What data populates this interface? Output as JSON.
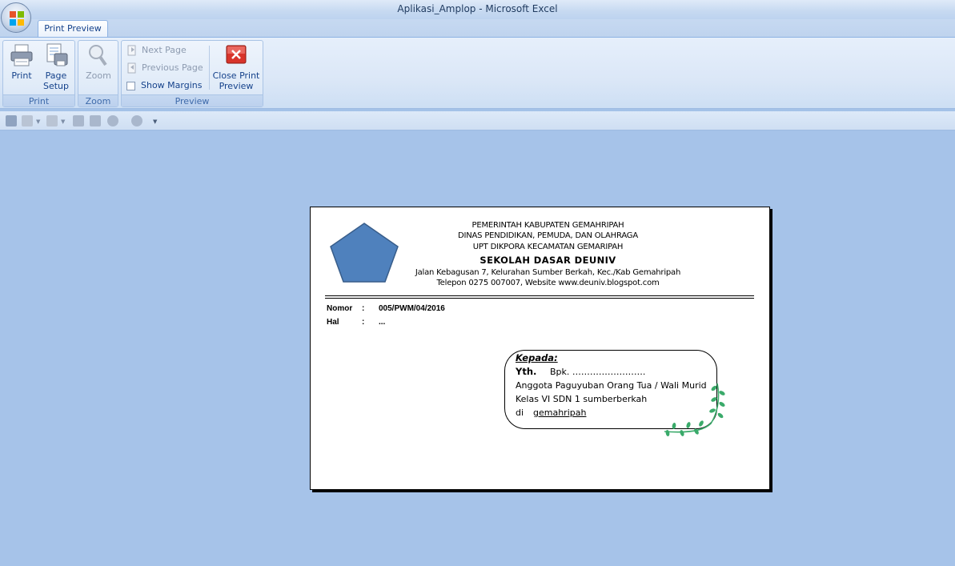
{
  "window": {
    "title": "Aplikasi_Amplop - Microsoft Excel"
  },
  "tabs": [
    {
      "label": "Print Preview"
    }
  ],
  "ribbon": {
    "print_group": {
      "label": "Print",
      "print_label": "Print",
      "page_setup_label_1": "Page",
      "page_setup_label_2": "Setup"
    },
    "zoom_group": {
      "label": "Zoom",
      "zoom_label": "Zoom"
    },
    "preview_group": {
      "label": "Preview",
      "next_page_label": "Next Page",
      "previous_page_label": "Previous Page",
      "show_margins_label": "Show Margins",
      "show_margins_checked": false,
      "close_label_1": "Close Print",
      "close_label_2": "Preview"
    }
  },
  "document": {
    "header_lines": [
      "PEMERINTAH KABUPATEN GEMAHRIPAH",
      "DINAS PENDIDIKAN, PEMUDA, DAN OLAHRAGA",
      "UPT DIKPORA KECAMATAN GEMARIPAH"
    ],
    "school_name": "SEKOLAH DASAR DEUNIV",
    "address": "Jalan Kebagusan 7, Kelurahan Sumber Berkah, Kec./Kab Gemahripah",
    "contact": "Telepon 0275 007007, Website www.deuniv.blogspot.com",
    "nomor_label": "Nomor",
    "nomor_sep": ":",
    "nomor_value": "005/PWM/04/2016",
    "hal_label": "Hal",
    "hal_sep": ":",
    "hal_value": "...",
    "recipient": {
      "kepada": "Kepada:",
      "yth": "Yth.",
      "bpk": "Bpk. …………………….",
      "line1": "Anggota Paguyuban Orang Tua / Wali Murid",
      "line2": "Kelas VI SDN 1 sumberberkah",
      "di": "di",
      "place": "gemahripah"
    },
    "logo_color": "#4f81bd",
    "ornament_color": "#3aaa6a"
  }
}
